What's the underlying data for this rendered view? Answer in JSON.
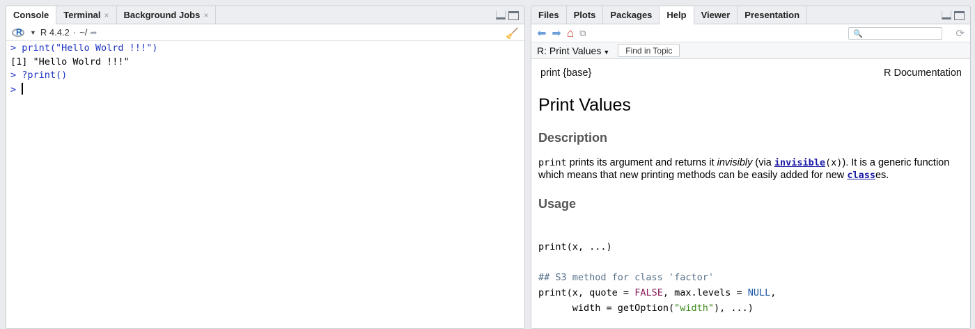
{
  "left": {
    "tabs": [
      {
        "label": "Console",
        "closable": false
      },
      {
        "label": "Terminal",
        "closable": true
      },
      {
        "label": "Background Jobs",
        "closable": true
      }
    ],
    "close_glyph": "×",
    "toolbar": {
      "r_version": "R 4.4.2",
      "separator": "·",
      "path": "~/"
    },
    "console_lines": [
      {
        "kind": "cmd",
        "text": "> print(\"Hello Wolrd !!!\")"
      },
      {
        "kind": "out",
        "text": "[1] \"Hello Wolrd !!!\""
      },
      {
        "kind": "cmd",
        "text": "> ?print()"
      },
      {
        "kind": "cmd",
        "text": "> "
      }
    ]
  },
  "right": {
    "tabs": [
      {
        "label": "Files"
      },
      {
        "label": "Plots"
      },
      {
        "label": "Packages"
      },
      {
        "label": "Help"
      },
      {
        "label": "Viewer"
      },
      {
        "label": "Presentation"
      }
    ],
    "active_tab": "Help",
    "search": {
      "value": "",
      "placeholder": ""
    },
    "topic": {
      "label": "R: Print Values",
      "find_label": "Find in Topic"
    },
    "doc": {
      "package": "print {base}",
      "source": "R Documentation",
      "title": "Print Values",
      "description_heading": "Description",
      "desc_code": "print",
      "desc_t1": " prints its argument and returns it ",
      "desc_em": "invisibly",
      "desc_t2": " (via ",
      "desc_link1": "invisible",
      "desc_code2": "(x)",
      "desc_t3": "). It is a generic function which means that new printing methods can be easily added for new ",
      "desc_link2": "class",
      "desc_t4": "es.",
      "usage_heading": "Usage"
    },
    "usage": {
      "l1": {
        "fn": "print",
        "args": "(x, ...)"
      },
      "comment": "## S3 method for class 'factor'",
      "l3": {
        "fn": "print",
        "a": "(x, quote = ",
        "kw1": "FALSE",
        "b": ", max.levels = ",
        "kw2": "NULL",
        "c": ","
      },
      "l4": {
        "indent": "      ",
        "a": "width = getOption(",
        "str": "\"width\"",
        "b": "), ...)"
      }
    }
  },
  "colors": {
    "command": "#1e34c2",
    "link": "#1a1aa6",
    "home_icon": "#c0392b",
    "nav_arrow": "#6f9fd9"
  }
}
